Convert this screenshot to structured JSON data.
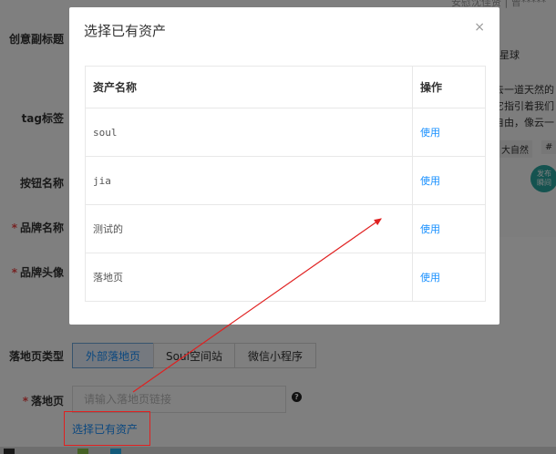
{
  "form": {
    "labels": {
      "subtitle": "创意副标题",
      "tag": "tag标签",
      "button_name": "按钮名称",
      "brand_name": "品牌名称",
      "brand_avatar": "品牌头像",
      "landing_type": "落地页类型",
      "landing_page": "落地页"
    },
    "required_mark": "*",
    "landing_types": [
      "外部落地页",
      "Soul空间站",
      "微信小程序"
    ],
    "landing_input_placeholder": "请输入落地页链接",
    "help_icon_glyph": "?",
    "select_asset_link": "选择已有资产"
  },
  "preview": {
    "lines": [
      "安慰沈佳贤 | 曾*****",
      "星球",
      "去一道天然的",
      "它指引着我们",
      "自由，像云一",
      "大自然",
      "#",
      "发布",
      "瞬间"
    ]
  },
  "modal": {
    "title": "选择已有资产",
    "close_glyph": "×",
    "columns": [
      "资产名称",
      "操作"
    ],
    "rows": [
      {
        "name": "soul",
        "action": "使用"
      },
      {
        "name": "jia",
        "action": "使用"
      },
      {
        "name": "测试的",
        "action": "使用"
      },
      {
        "name": "落地页",
        "action": "使用"
      }
    ]
  },
  "colors": {
    "link": "#1890ff",
    "annotation": "#e02020"
  }
}
